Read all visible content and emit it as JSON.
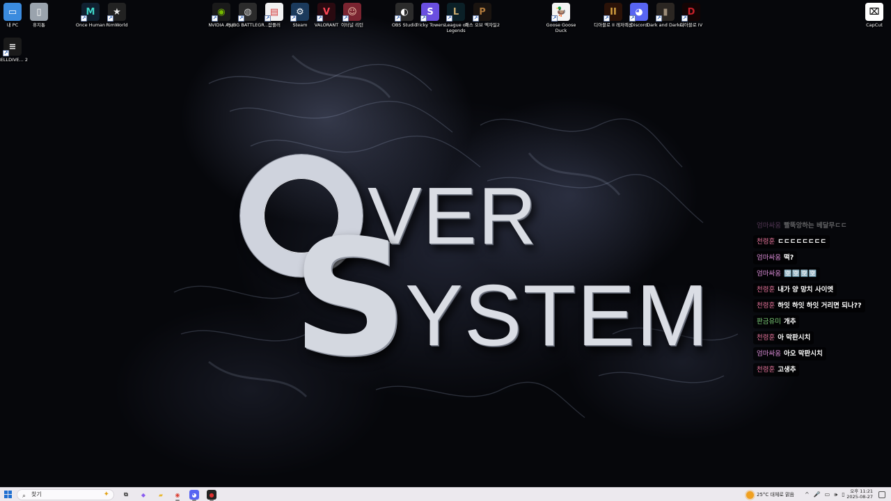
{
  "desktop": {
    "icons": [
      {
        "label": "내 PC",
        "icon": "pc-icon",
        "glyph": "▭",
        "bg": "#3b8bde",
        "fg": "#ffffff"
      },
      {
        "label": "휴지통",
        "icon": "recycle-bin-icon",
        "glyph": "▯",
        "bg": "#9aa3ad",
        "fg": "#ffffff"
      },
      {
        "label": "Once Human",
        "icon": "once-human-icon",
        "glyph": "M",
        "bg": "#102030",
        "fg": "#3fd6c8"
      },
      {
        "label": "RimWorld",
        "icon": "rimworld-icon",
        "glyph": "★",
        "bg": "#222222",
        "fg": "#e8e8e8"
      },
      {
        "label": "NVIDIA App",
        "icon": "nvidia-icon",
        "glyph": "◉",
        "bg": "#1a1a1a",
        "fg": "#76b900"
      },
      {
        "label": "PUBG BATTLEGR...",
        "icon": "pubg-icon",
        "glyph": "◍",
        "bg": "#2b2b2b",
        "fg": "#cfcfcf"
      },
      {
        "label": "잡플러",
        "icon": "jobplus-icon",
        "glyph": "▤",
        "bg": "#f2f2f2",
        "fg": "#d43b3b"
      },
      {
        "label": "Steam",
        "icon": "steam-icon",
        "glyph": "⚙",
        "bg": "#1b3a5c",
        "fg": "#ffffff"
      },
      {
        "label": "VALORANT",
        "icon": "valorant-icon",
        "glyph": "V",
        "bg": "#2a0a10",
        "fg": "#ff4655"
      },
      {
        "label": "이터널 리턴",
        "icon": "eternal-return-icon",
        "glyph": "☺",
        "bg": "#7a2430",
        "fg": "#f4c7b0"
      },
      {
        "label": "OBS Studio",
        "icon": "obs-icon",
        "glyph": "◐",
        "bg": "#2b2b2b",
        "fg": "#ffffff"
      },
      {
        "label": "Tricky Towers",
        "icon": "tricky-towers-icon",
        "glyph": "S",
        "bg": "#6a4fe0",
        "fg": "#ffffff"
      },
      {
        "label": "League of Legends",
        "icon": "league-of-legends-icon",
        "glyph": "L",
        "bg": "#0b2027",
        "fg": "#c8aa6e"
      },
      {
        "label": "패스 오브 엑자일2",
        "icon": "path-of-exile-icon",
        "glyph": "P",
        "bg": "#1a1410",
        "fg": "#b07a3c"
      },
      {
        "label": "Goose Goose Duck",
        "icon": "goose-goose-duck-icon",
        "glyph": "🦆",
        "bg": "#f4f4f4",
        "fg": "#e08a1e"
      },
      {
        "label": "디아블로 II 레저렉션",
        "icon": "diablo-2-icon",
        "glyph": "II",
        "bg": "#2a1208",
        "fg": "#d4a040"
      },
      {
        "label": "Discord",
        "icon": "discord-icon",
        "glyph": "◕",
        "bg": "#5865f2",
        "fg": "#ffffff"
      },
      {
        "label": "Dark and Darker",
        "icon": "dark-and-darker-icon",
        "glyph": "▮",
        "bg": "#2b2622",
        "fg": "#9c8c78"
      },
      {
        "label": "디아블로 IV",
        "icon": "diablo-4-icon",
        "glyph": "D",
        "bg": "#140404",
        "fg": "#c8202a"
      },
      {
        "label": "CapCut",
        "icon": "capcut-icon",
        "glyph": "⌧",
        "bg": "#ffffff",
        "fg": "#000000"
      },
      {
        "label": "HELLDIVE... 2",
        "icon": "helldivers-2-icon",
        "glyph": "≡",
        "bg": "#1a1a1a",
        "fg": "#e8e8e8"
      }
    ]
  },
  "logo": {
    "letter_o": "O",
    "letter_s": "S",
    "word_ver": "VER",
    "word_system": "YSTEM"
  },
  "chat": {
    "messages": [
      {
        "user": "엄마싸움",
        "text": "빨뚝앙하는 베달무ㄷㄷ",
        "user_color": "#d98bd6",
        "faded": true
      },
      {
        "user": "천령훈",
        "text": "ㄷㄷㄷㄷㄷㄷㄷㄷ",
        "user_color": "#e7759c",
        "faded": false
      },
      {
        "user": "엄마싸움",
        "text": "떡?",
        "user_color": "#d98bd6",
        "faded": false
      },
      {
        "user": "엄마싸움",
        "text": "🈳🈳🈳🈳",
        "user_color": "#d98bd6",
        "faded": false
      },
      {
        "user": "천령훈",
        "text": "내가 양 망치 사이엣",
        "user_color": "#e7759c",
        "faded": false
      },
      {
        "user": "천령훈",
        "text": "하잇 하잇 하잇 거리면 되나??",
        "user_color": "#e7759c",
        "faded": false
      },
      {
        "user": "판금유미",
        "text": "개추",
        "user_color": "#7fd17a",
        "faded": false
      },
      {
        "user": "천령훈",
        "text": "아 막판시치",
        "user_color": "#e7759c",
        "faded": false
      },
      {
        "user": "엄마싸움",
        "text": "아오 막판시치",
        "user_color": "#d98bd6",
        "faded": false
      },
      {
        "user": "천령훈",
        "text": "고생추",
        "user_color": "#e7759c",
        "faded": false
      }
    ]
  },
  "taskbar": {
    "search_placeholder": "찾기",
    "apps": [
      {
        "name": "task-view",
        "icon": "task-view-icon",
        "glyph": "⧉",
        "bg": "transparent",
        "fg": "#333333"
      },
      {
        "name": "copilot",
        "icon": "copilot-icon",
        "glyph": "◆",
        "bg": "transparent",
        "fg": "#8a5cf0"
      },
      {
        "name": "file-explorer",
        "icon": "folder-icon",
        "glyph": "▰",
        "bg": "transparent",
        "fg": "#e8b830"
      },
      {
        "name": "chrome",
        "icon": "chrome-icon",
        "glyph": "◉",
        "bg": "transparent",
        "fg": "#db4437"
      },
      {
        "name": "discord",
        "icon": "discord-icon",
        "glyph": "◕",
        "bg": "#5865f2",
        "fg": "#ffffff"
      },
      {
        "name": "recorder",
        "icon": "record-icon",
        "glyph": "●",
        "bg": "#222222",
        "fg": "#e03030"
      }
    ],
    "weather": {
      "temp": "25°C",
      "desc": "대체로 맑음"
    },
    "tray": {
      "chevron": "^",
      "mic": "🎤",
      "network": "▭",
      "volume": "🕪",
      "battery": "▯"
    },
    "clock": {
      "time": "오후 11:21",
      "date": "2025-08-27"
    }
  }
}
